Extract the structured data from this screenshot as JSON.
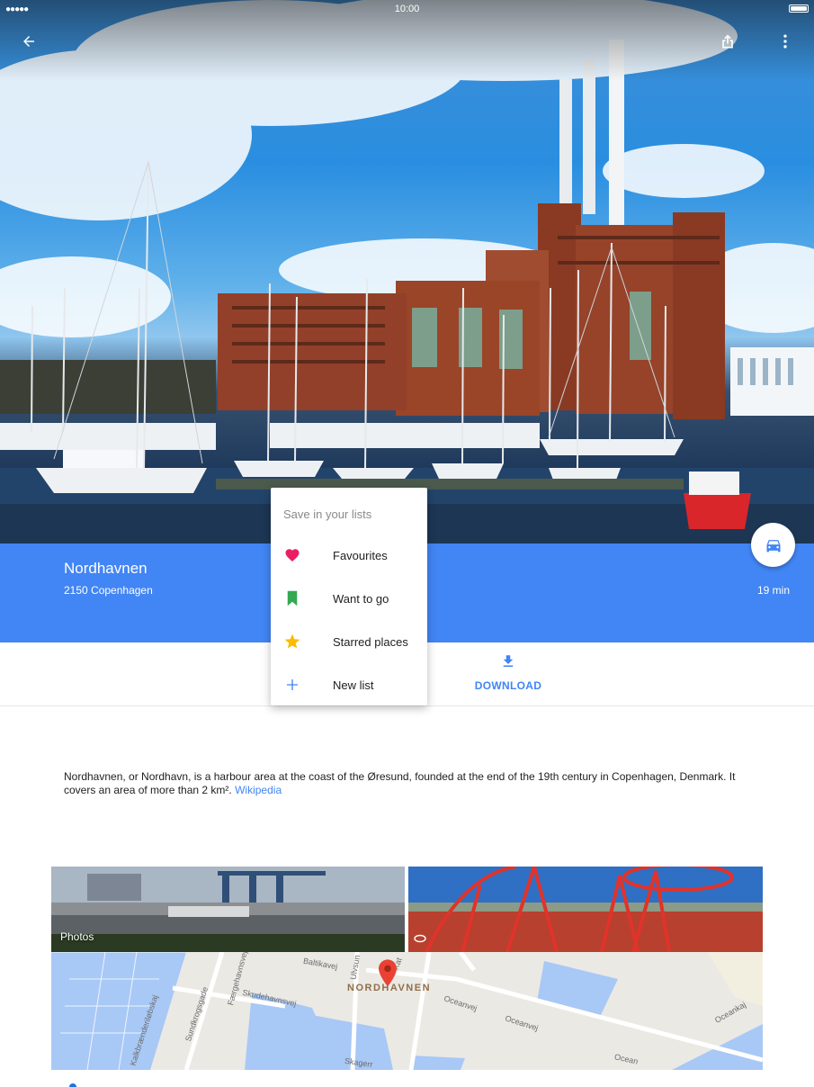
{
  "status_bar": {
    "signal": "●●●●●",
    "time": "10:00"
  },
  "toolbar": {
    "back_icon": "arrow-back-icon",
    "share_icon": "share-icon",
    "more_icon": "more-vert-icon"
  },
  "place": {
    "name": "Nordhavnen",
    "address": "2150 Copenhagen",
    "travel_time": "19 min",
    "travel_mode_icon": "car-icon"
  },
  "actions": {
    "download_label": "DOWNLOAD"
  },
  "save_menu": {
    "title": "Save in your lists",
    "items": [
      {
        "label": "Favourites",
        "icon": "heart-icon",
        "color": "#e91e63"
      },
      {
        "label": "Want to go",
        "icon": "bookmark-flag-icon",
        "color": "#34a853"
      },
      {
        "label": "Starred places",
        "icon": "star-icon",
        "color": "#fbbc04"
      },
      {
        "label": "New list",
        "icon": "plus-icon",
        "color": "#4285f4"
      }
    ]
  },
  "description": {
    "text": "Nordhavnen, or Nordhavn, is a harbour area at the coast of the Øresund, founded at the end of the 19th century in Copenhagen, Denmark. It covers an area of more than 2 km².",
    "source_link": "Wikipedia"
  },
  "gallery": {
    "photos_label": "Photos"
  },
  "map": {
    "area_label": "NORDHAVNEN",
    "streets": [
      "Baltikavej",
      "Ulvsun",
      "Færgehavnsvej",
      "Skudehavnsvej",
      "Sundkrogsgade",
      "Kalkbrænderiløbskaj",
      "Oceanvej",
      "Oceanvej",
      "Oceankaj",
      "Skagerr",
      "Ocean",
      "Kat"
    ]
  },
  "colors": {
    "brand_blue": "#4285f4",
    "menu_text": "#212121"
  }
}
